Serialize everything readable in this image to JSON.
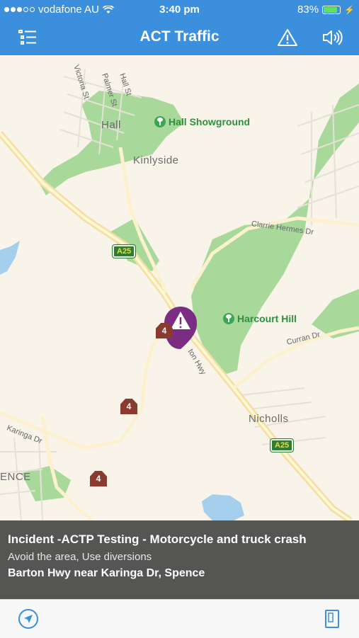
{
  "status_bar": {
    "carrier": "vodafone AU",
    "time": "3:40 pm",
    "battery": "83%",
    "battery_level": 0.83
  },
  "nav": {
    "title": "ACT Traffic",
    "menu_icon": "list-icon",
    "alert_icon": "warning-icon",
    "sound_icon": "speaker-icon"
  },
  "map": {
    "suburbs": [
      "Hall",
      "Kinlyside",
      "Nicholls",
      "ENCE"
    ],
    "parks": [
      "Hall Showground",
      "Harcourt Hill"
    ],
    "streets": [
      "Victoria St",
      "Palmer St",
      "Hall St",
      "Clarrie Hermes Dr",
      "Curran Dr",
      "Karinga Dr",
      "ton Hwy"
    ],
    "route_shields": [
      "A25",
      "A25",
      "4",
      "4",
      "4"
    ],
    "incident_marker_icon": "warning-marker-icon"
  },
  "incident": {
    "title": "Incident -ACTP Testing - Motorcycle and truck crash",
    "advice": "Avoid the area, Use diversions",
    "location": "Barton Hwy near Karinga Dr, Spence"
  },
  "bottom": {
    "locate_icon": "location-arrow-icon",
    "details_icon": "document-icon"
  },
  "colors": {
    "accent": "#3b8fdd",
    "incident": "#7b2c83",
    "park": "#a8d89a"
  }
}
